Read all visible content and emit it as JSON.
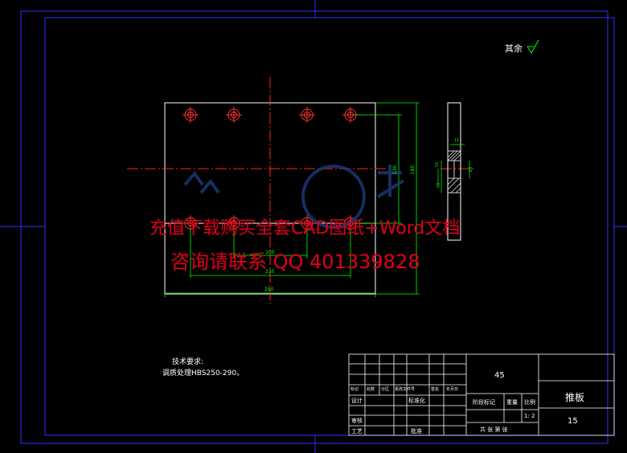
{
  "drawing": {
    "surface_note": "其余",
    "tech_req_title": "技术要求:",
    "tech_req_line": "调质处理HBS250-290。",
    "dims": {
      "width_total": "290",
      "inner_width": "230",
      "small_span": "100",
      "height_outer": "180",
      "height_inner": "130",
      "side_top": "11",
      "side_a": "15",
      "side_b": "30",
      "side_c": "20"
    }
  },
  "watermark": {
    "line1": "充值下载购买全套CAD图纸+Word文档",
    "line2": "咨询请联系  QQ 401339828"
  },
  "title_block": {
    "material": "45",
    "part_name": "推板",
    "drawing_no": "15",
    "scale": "1: 2",
    "row_headers": [
      "标记",
      "处数",
      "分区",
      "更改文件号",
      "签名",
      "年月日"
    ],
    "labels": {
      "design": "设计",
      "standardize": "标准化",
      "review": "审核",
      "process": "工艺",
      "approve": "批准",
      "stage_mark": "阶段标记",
      "weight": "重量",
      "ratio": "比例",
      "sheets": "共   张 第   张"
    }
  },
  "colors": {
    "background": "#000000",
    "frame": "#0000ff",
    "part": "#ffffff",
    "dimension": "#00ff00",
    "centerline": "#ff0000",
    "hole": "#ff0000",
    "watermark": "#e0001a"
  }
}
